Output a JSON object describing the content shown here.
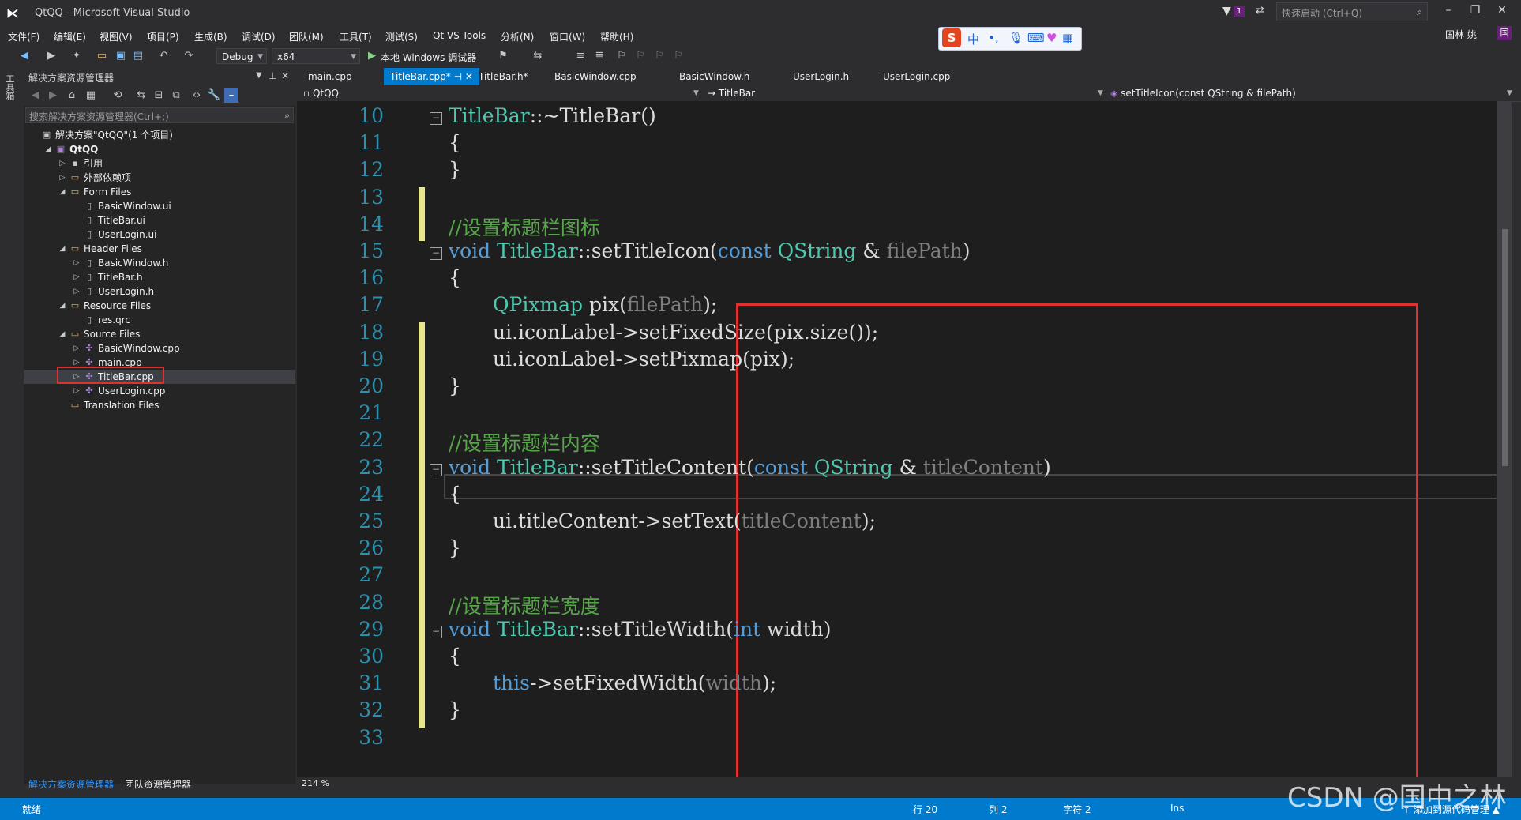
{
  "window": {
    "title": "QtQQ - Microsoft Visual Studio",
    "quick_launch_placeholder": "快速启动 (Ctrl+Q)",
    "notification_count": "1",
    "user_name": "国林 姚",
    "user_initial": "国"
  },
  "menu": [
    "文件(F)",
    "编辑(E)",
    "视图(V)",
    "项目(P)",
    "生成(B)",
    "调试(D)",
    "团队(M)",
    "工具(T)",
    "测试(S)",
    "Qt VS Tools",
    "分析(N)",
    "窗口(W)",
    "帮助(H)"
  ],
  "toolbar": {
    "config": "Debug",
    "platform": "x64",
    "run_label": "本地 Windows 调试器"
  },
  "ime": {
    "chinese_label": "中"
  },
  "left_strip": {
    "label": "工具箱"
  },
  "solution_explorer": {
    "title": "解决方案资源管理器",
    "search_placeholder": "搜索解决方案资源管理器(Ctrl+;)",
    "bottom_tabs": [
      "解决方案资源管理器",
      "团队资源管理器"
    ],
    "tree": [
      {
        "label": "解决方案\"QtQQ\"(1 个项目)",
        "depth": 0,
        "toggle": "",
        "icon": "solution-icon"
      },
      {
        "label": "QtQQ",
        "depth": 1,
        "toggle": "expanded",
        "icon": "project-icon",
        "bold": true
      },
      {
        "label": "引用",
        "depth": 2,
        "toggle": "collapsed",
        "icon": "references-icon"
      },
      {
        "label": "外部依赖项",
        "depth": 2,
        "toggle": "collapsed",
        "icon": "folder-icon"
      },
      {
        "label": "Form Files",
        "depth": 2,
        "toggle": "expanded",
        "icon": "folder-icon"
      },
      {
        "label": "BasicWindow.ui",
        "depth": 3,
        "toggle": "",
        "icon": "file-icon"
      },
      {
        "label": "TitleBar.ui",
        "depth": 3,
        "toggle": "",
        "icon": "file-icon"
      },
      {
        "label": "UserLogin.ui",
        "depth": 3,
        "toggle": "",
        "icon": "file-icon"
      },
      {
        "label": "Header Files",
        "depth": 2,
        "toggle": "expanded",
        "icon": "folder-icon"
      },
      {
        "label": "BasicWindow.h",
        "depth": 3,
        "toggle": "collapsed",
        "icon": "file-icon"
      },
      {
        "label": "TitleBar.h",
        "depth": 3,
        "toggle": "collapsed",
        "icon": "file-icon"
      },
      {
        "label": "UserLogin.h",
        "depth": 3,
        "toggle": "collapsed",
        "icon": "file-icon"
      },
      {
        "label": "Resource Files",
        "depth": 2,
        "toggle": "expanded",
        "icon": "folder-icon"
      },
      {
        "label": "res.qrc",
        "depth": 3,
        "toggle": "",
        "icon": "file-icon"
      },
      {
        "label": "Source Files",
        "depth": 2,
        "toggle": "expanded",
        "icon": "folder-icon"
      },
      {
        "label": "BasicWindow.cpp",
        "depth": 3,
        "toggle": "collapsed",
        "icon": "cpp-file-icon"
      },
      {
        "label": "main.cpp",
        "depth": 3,
        "toggle": "collapsed",
        "icon": "cpp-file-icon"
      },
      {
        "label": "TitleBar.cpp",
        "depth": 3,
        "toggle": "collapsed",
        "icon": "cpp-file-icon",
        "selected": true
      },
      {
        "label": "UserLogin.cpp",
        "depth": 3,
        "toggle": "collapsed",
        "icon": "cpp-file-icon"
      },
      {
        "label": "Translation Files",
        "depth": 2,
        "toggle": "",
        "icon": "folder-icon"
      }
    ]
  },
  "tabs": [
    {
      "label": "main.cpp",
      "active": false
    },
    {
      "label": "TitleBar.cpp*",
      "active": true
    },
    {
      "label": "TitleBar.h*",
      "active": false
    },
    {
      "label": "BasicWindow.cpp",
      "active": false
    },
    {
      "label": "BasicWindow.h",
      "active": false
    },
    {
      "label": "UserLogin.h",
      "active": false
    },
    {
      "label": "UserLogin.cpp",
      "active": false
    }
  ],
  "navbar": {
    "project": "QtQQ",
    "scope": "TitleBar",
    "member": "setTitleIcon(const QString & filePath)"
  },
  "code_lines": [
    {
      "n": "10",
      "text": "TitleBar::~TitleBar()"
    },
    {
      "n": "11",
      "text": "{"
    },
    {
      "n": "12",
      "text": "}"
    },
    {
      "n": "13",
      "text": ""
    },
    {
      "n": "14",
      "text": "//设置标题栏图标"
    },
    {
      "n": "15",
      "text": "void TitleBar::setTitleIcon(const QString & filePath)"
    },
    {
      "n": "16",
      "text": "{"
    },
    {
      "n": "17",
      "text": "QPixmap pix(filePath);"
    },
    {
      "n": "18",
      "text": "ui.iconLabel->setFixedSize(pix.size());"
    },
    {
      "n": "19",
      "text": "ui.iconLabel->setPixmap(pix);"
    },
    {
      "n": "20",
      "text": "}"
    },
    {
      "n": "21",
      "text": ""
    },
    {
      "n": "22",
      "text": "//设置标题栏内容"
    },
    {
      "n": "23",
      "text": "void TitleBar::setTitleContent(const QString & titleContent)"
    },
    {
      "n": "24",
      "text": "{"
    },
    {
      "n": "25",
      "text": "ui.titleContent->setText(titleContent);"
    },
    {
      "n": "26",
      "text": "}"
    },
    {
      "n": "27",
      "text": ""
    },
    {
      "n": "28",
      "text": "//设置标题栏宽度"
    },
    {
      "n": "29",
      "text": "void TitleBar::setTitleWidth(int width)"
    },
    {
      "n": "30",
      "text": "{"
    },
    {
      "n": "31",
      "text": "this->setFixedWidth(width);"
    },
    {
      "n": "32",
      "text": "}"
    },
    {
      "n": "33",
      "text": ""
    }
  ],
  "zoom": "214 %",
  "status": {
    "ready": "就绪",
    "line": "行 20",
    "col": "列 2",
    "char": "字符 2",
    "mode": "Ins",
    "source_control": "↑ 添加到源代码管理 ▲"
  },
  "watermark": "CSDN @国中之林",
  "colors": {
    "accent": "#007acc",
    "highlight_box": "#e03030",
    "comment": "#57a64a",
    "keyword": "#569cd6",
    "type": "#4ec9b0"
  }
}
